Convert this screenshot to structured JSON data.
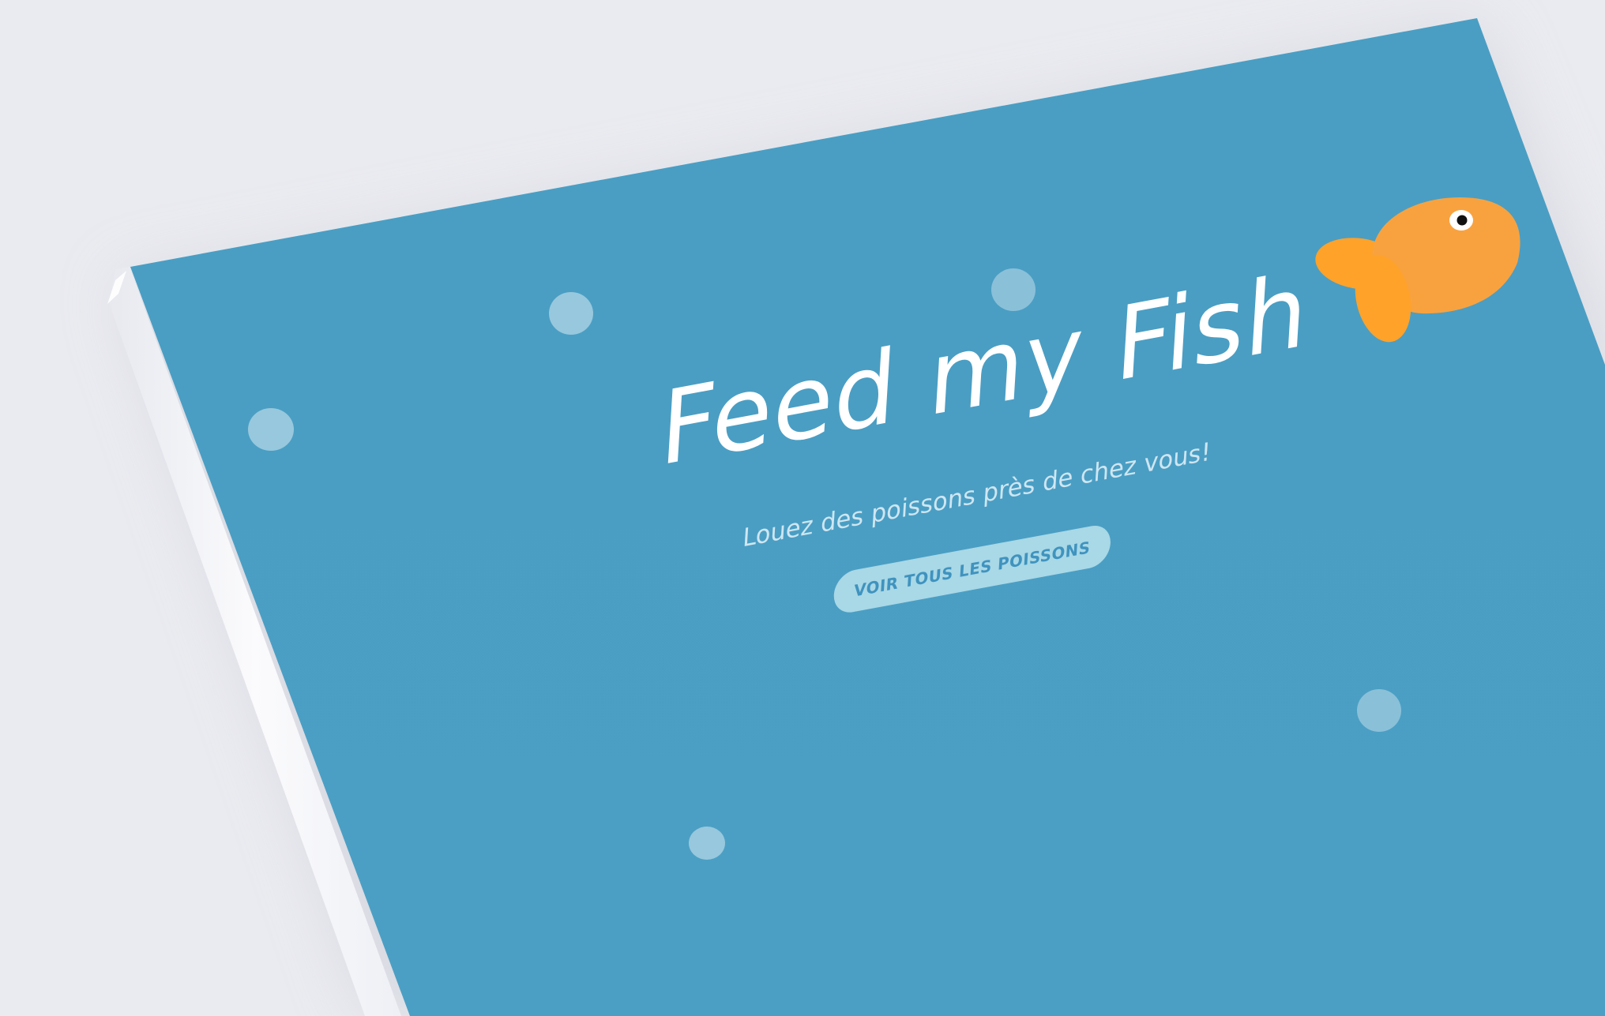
{
  "hero": {
    "title": "Feed my Fish",
    "subtitle": "Louez des poissons près de chez vous!",
    "cta_label": "VOIR TOUS LES POISSONS"
  },
  "colors": {
    "background": "#eaebf0",
    "screen": "#4a9ec3",
    "device_edge": "#f4f5f9",
    "bubble": "#a6cfe2",
    "fish_body": "#f8a23f",
    "fish_fin": "#ffa22a",
    "cta_background": "#a9d8e6",
    "cta_text": "#3f93bf"
  },
  "icons": [
    "goldfish-icon",
    "bubble-icon"
  ]
}
